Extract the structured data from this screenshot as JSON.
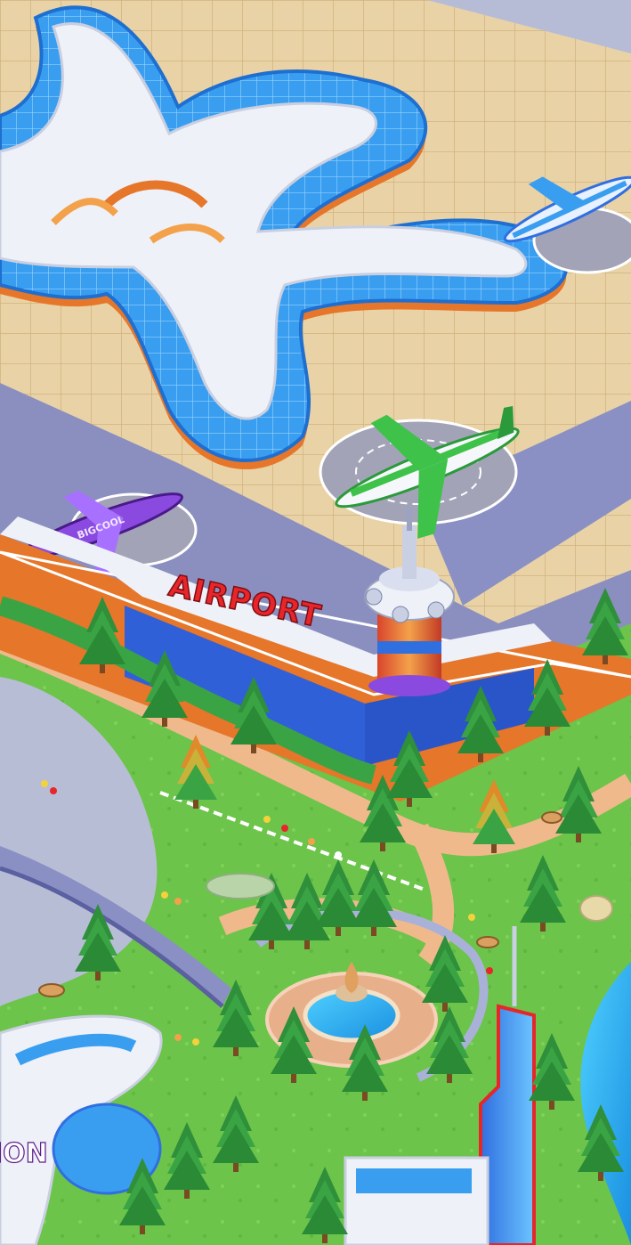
{
  "scene": {
    "airport_sign": "AIRPORT",
    "plane_livery": "BIGCOOL",
    "station_sign_partial": "ION"
  },
  "colors": {
    "tarmac_tile": "#e9d3a6",
    "tarmac_grid": "#d1b27e",
    "terminal_roof": "#e8edf6",
    "terminal_glass": "#3a9ef0",
    "terminal_orange": "#e6762a",
    "grass": "#6cc44a",
    "road": "#f0b98c",
    "river": "#b8bdd6",
    "pine": "#2f8f3a",
    "airport_sign_red": "#e8262a"
  }
}
